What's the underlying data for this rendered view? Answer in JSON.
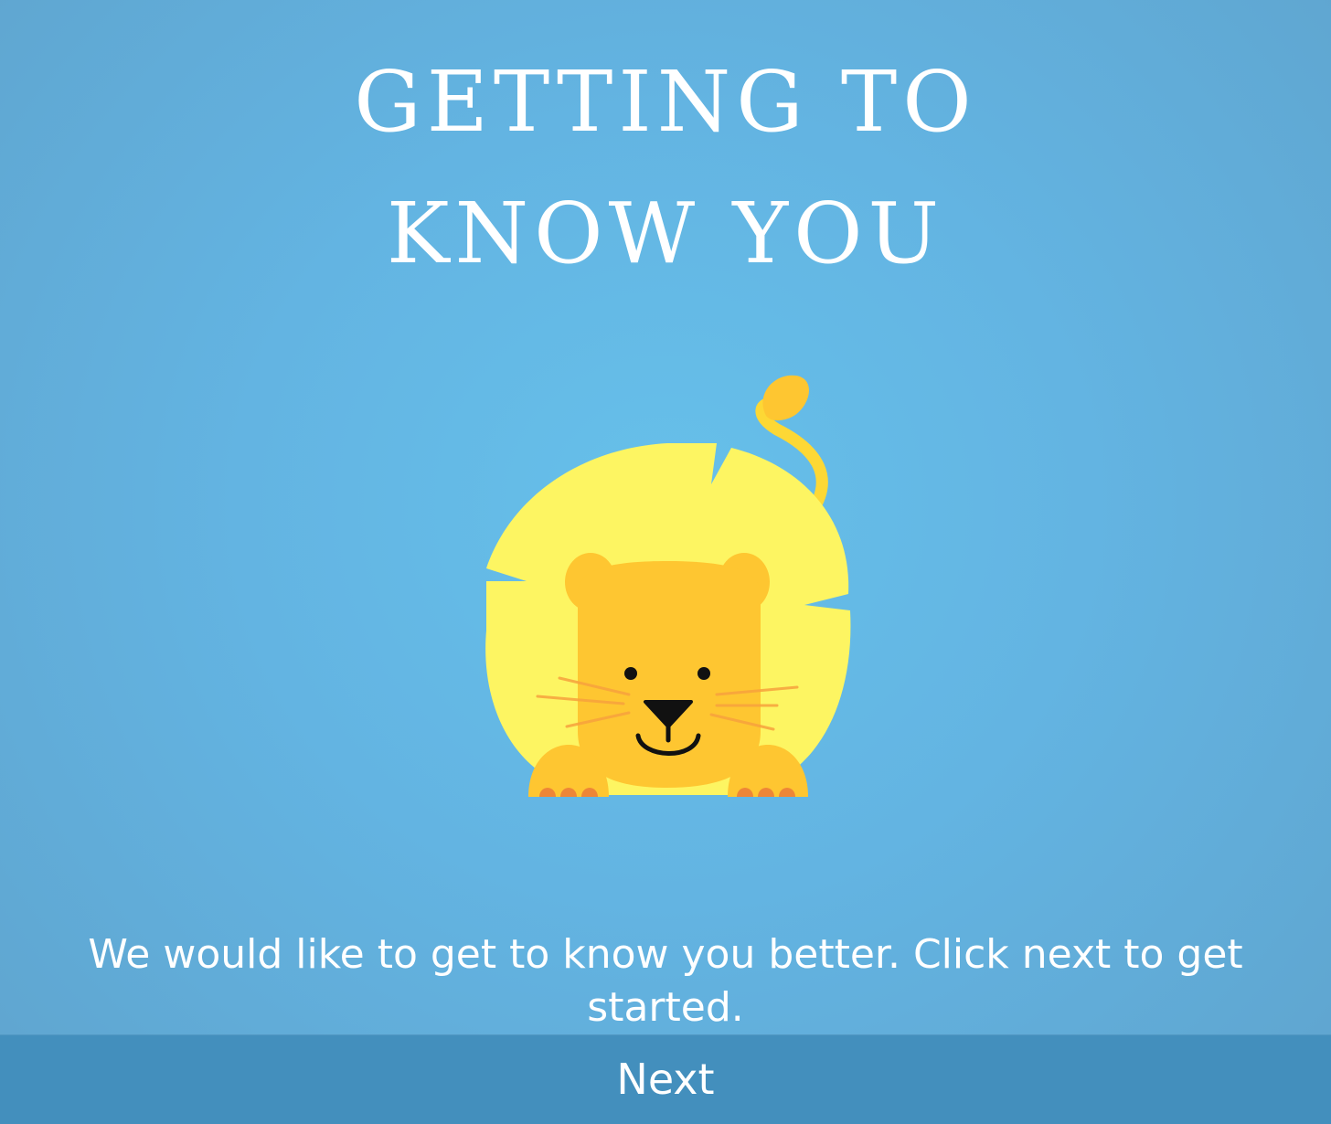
{
  "header": {
    "title_line1": "GETTING TO",
    "title_line2": "KNOW YOU"
  },
  "mascot": {
    "icon": "lion-icon",
    "colors": {
      "mane": "#fdf562",
      "face": "#fec631",
      "paw_pads": "#ee8637",
      "whiskers": "#f7a23d",
      "features": "#111111"
    }
  },
  "main": {
    "intro_text": "We would like to get to know you better. Click next to get started."
  },
  "footer": {
    "next_label": "Next"
  },
  "theme": {
    "background": "#66c0ea",
    "button_bar": "#438fbd",
    "text": "#ffffff"
  }
}
